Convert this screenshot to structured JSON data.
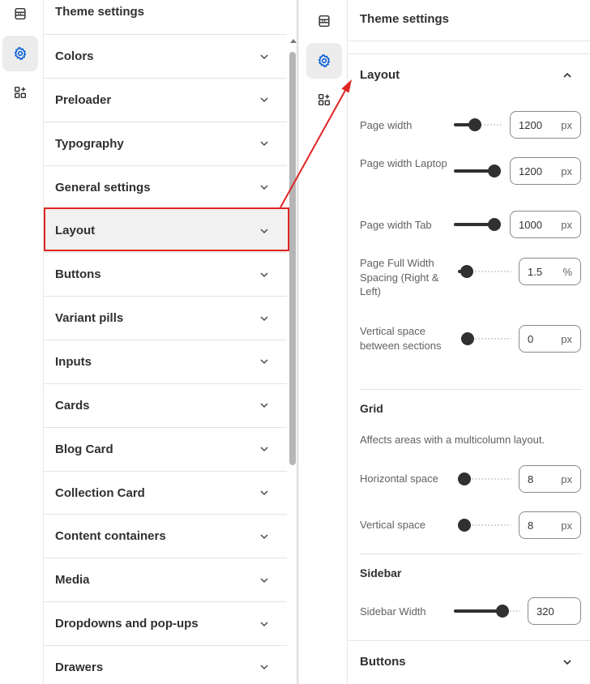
{
  "left_panel": {
    "header": "Theme settings",
    "items": [
      {
        "label": "Colors"
      },
      {
        "label": "Preloader"
      },
      {
        "label": "Typography"
      },
      {
        "label": "General settings"
      },
      {
        "label": "Layout"
      },
      {
        "label": "Buttons"
      },
      {
        "label": "Variant pills"
      },
      {
        "label": "Inputs"
      },
      {
        "label": "Cards"
      },
      {
        "label": "Blog Card"
      },
      {
        "label": "Collection Card"
      },
      {
        "label": "Content containers"
      },
      {
        "label": "Media"
      },
      {
        "label": "Dropdowns and pop-ups"
      },
      {
        "label": "Drawers"
      }
    ],
    "highlighted_item": "Layout",
    "highlight_color": "#e02424"
  },
  "rail": {
    "icons": [
      "sections-icon",
      "gear-icon",
      "apps-icon"
    ],
    "active": "gear-icon",
    "active_color": "#005bd3"
  },
  "right_panel": {
    "header": "Theme settings",
    "layout_section": {
      "title": "Layout",
      "settings": [
        {
          "label": "Page width",
          "value": "1200",
          "unit": "px",
          "slider_fraction": 0.43
        },
        {
          "label": "Page width Laptop",
          "value": "1200",
          "unit": "px",
          "slider_fraction": 1.0
        },
        {
          "label": "Page width Tab",
          "value": "1000",
          "unit": "px",
          "slider_fraction": 1.0
        },
        {
          "label": "Page Full Width Spacing (Right & Left)",
          "value": "1.5",
          "unit": "%",
          "slider_fraction": 0.17
        },
        {
          "label": "Vertical space between sections",
          "value": "0",
          "unit": "px",
          "slider_fraction": 0.0
        }
      ]
    },
    "grid_section": {
      "title": "Grid",
      "description": "Affects areas with a multicolumn layout.",
      "settings": [
        {
          "label": "Horizontal space",
          "value": "8",
          "unit": "px",
          "slider_fraction": 0.11
        },
        {
          "label": "Vertical space",
          "value": "8",
          "unit": "px",
          "slider_fraction": 0.11
        }
      ]
    },
    "sidebar_section": {
      "title": "Sidebar",
      "settings": [
        {
          "label": "Sidebar Width",
          "value": "320",
          "slider_fraction": 0.73
        }
      ]
    },
    "buttons_section": {
      "title": "Buttons"
    }
  }
}
